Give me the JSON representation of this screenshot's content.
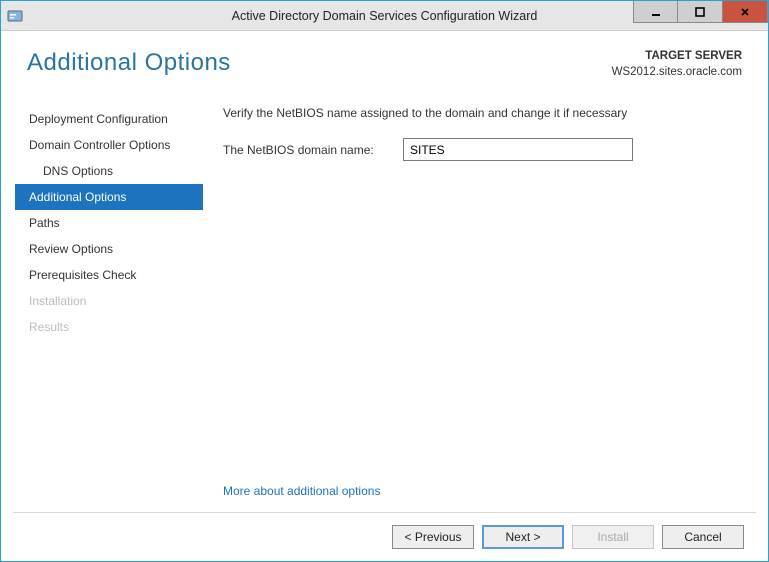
{
  "window": {
    "title": "Active Directory Domain Services Configuration Wizard"
  },
  "header": {
    "page_title": "Additional Options",
    "target_label": "TARGET SERVER",
    "target_value": "WS2012.sites.oracle.com"
  },
  "sidebar": {
    "steps": [
      {
        "label": "Deployment Configuration",
        "indent": false,
        "active": false,
        "disabled": false
      },
      {
        "label": "Domain Controller Options",
        "indent": false,
        "active": false,
        "disabled": false
      },
      {
        "label": "DNS Options",
        "indent": true,
        "active": false,
        "disabled": false
      },
      {
        "label": "Additional Options",
        "indent": false,
        "active": true,
        "disabled": false
      },
      {
        "label": "Paths",
        "indent": false,
        "active": false,
        "disabled": false
      },
      {
        "label": "Review Options",
        "indent": false,
        "active": false,
        "disabled": false
      },
      {
        "label": "Prerequisites Check",
        "indent": false,
        "active": false,
        "disabled": false
      },
      {
        "label": "Installation",
        "indent": false,
        "active": false,
        "disabled": true
      },
      {
        "label": "Results",
        "indent": false,
        "active": false,
        "disabled": true
      }
    ]
  },
  "main": {
    "instruction": "Verify the NetBIOS name assigned to the domain and change it if necessary",
    "netbios_label": "The NetBIOS domain name:",
    "netbios_value": "SITES",
    "more_link": "More about additional options"
  },
  "footer": {
    "previous": "< Previous",
    "next": "Next >",
    "install": "Install",
    "cancel": "Cancel"
  }
}
